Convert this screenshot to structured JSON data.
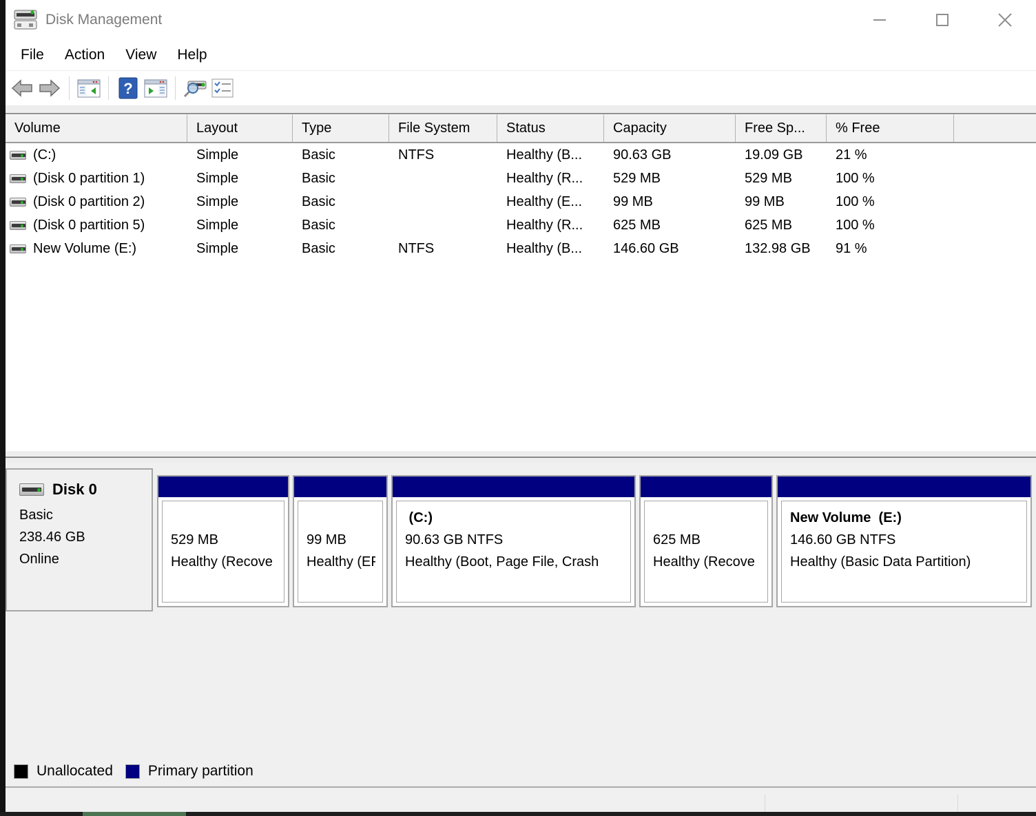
{
  "window": {
    "title": "Disk Management",
    "controls": {
      "minimize": "minimize",
      "maximize": "maximize",
      "close": "close"
    }
  },
  "menu": {
    "items": [
      "File",
      "Action",
      "View",
      "Help"
    ]
  },
  "toolbar": {
    "icons": [
      "back",
      "forward",
      "show-console-tree",
      "help",
      "show-action-pane",
      "connect-device",
      "disk-list"
    ]
  },
  "table": {
    "columns": [
      "Volume",
      "Layout",
      "Type",
      "File System",
      "Status",
      "Capacity",
      "Free Sp...",
      "% Free"
    ],
    "rows": [
      {
        "cells": [
          "(C:)",
          "Simple",
          "Basic",
          "NTFS",
          "Healthy (B...",
          "90.63 GB",
          "19.09 GB",
          "21 %"
        ]
      },
      {
        "cells": [
          "(Disk 0 partition 1)",
          "Simple",
          "Basic",
          "",
          "Healthy (R...",
          "529 MB",
          "529 MB",
          "100 %"
        ]
      },
      {
        "cells": [
          "(Disk 0 partition 2)",
          "Simple",
          "Basic",
          "",
          "Healthy (E...",
          "99 MB",
          "99 MB",
          "100 %"
        ]
      },
      {
        "cells": [
          "(Disk 0 partition 5)",
          "Simple",
          "Basic",
          "",
          "Healthy (R...",
          "625 MB",
          "625 MB",
          "100 %"
        ]
      },
      {
        "cells": [
          "New Volume (E:)",
          "Simple",
          "Basic",
          "NTFS",
          "Healthy (B...",
          "146.60 GB",
          "132.98 GB",
          "91 %"
        ]
      }
    ]
  },
  "disk_graph": {
    "disk": {
      "name": "Disk 0",
      "type": "Basic",
      "size": "238.46 GB",
      "status": "Online"
    },
    "partitions": [
      {
        "name": "",
        "size": "529 MB",
        "status": "Healthy (Recove"
      },
      {
        "name": "",
        "size": "99 MB",
        "status": "Healthy (EF"
      },
      {
        "name": " (C:)",
        "size": "90.63 GB NTFS",
        "status": "Healthy (Boot, Page File, Crash"
      },
      {
        "name": "",
        "size": "625 MB",
        "status": "Healthy (Recove"
      },
      {
        "name": "New Volume  (E:)",
        "size": "146.60 GB NTFS",
        "status": "Healthy (Basic Data Partition)"
      }
    ]
  },
  "legend": {
    "items": [
      {
        "label": "Unallocated",
        "color": "#000000"
      },
      {
        "label": "Primary partition",
        "color": "#000080"
      }
    ]
  },
  "colors": {
    "primary_partition": "#000080",
    "unallocated": "#000000",
    "title_text": "#7b7b7b"
  }
}
